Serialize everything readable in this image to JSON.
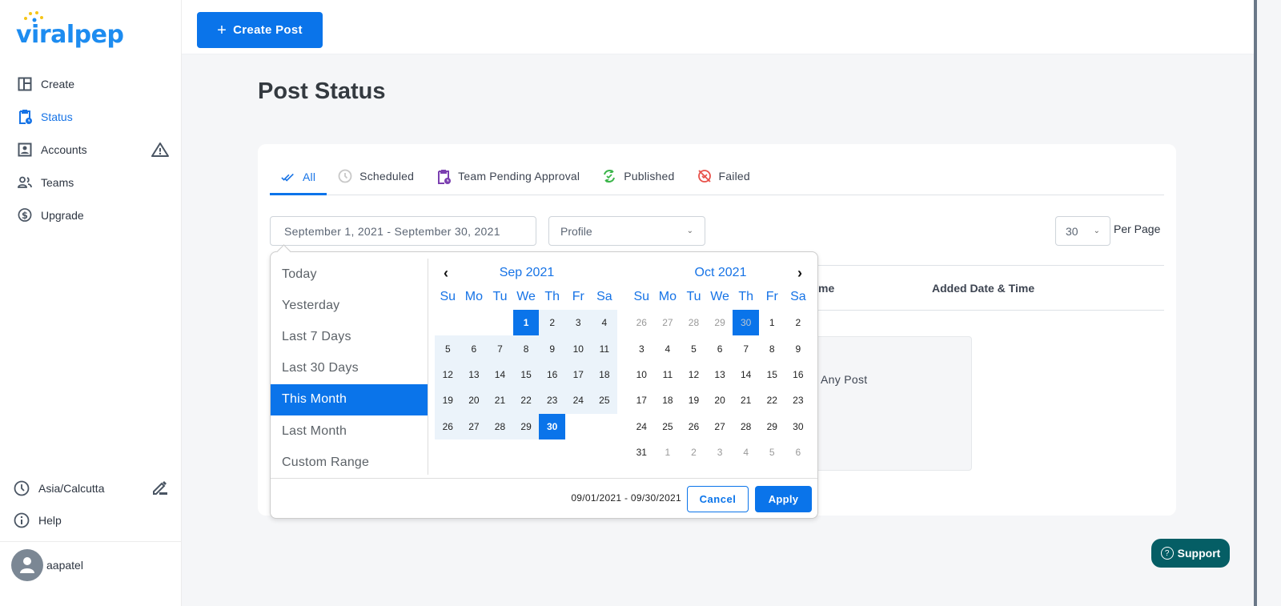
{
  "app": {
    "logo_text": "viralpep",
    "brand_color": "#1d8cf0",
    "accent_color": "#0a74ea"
  },
  "sidebar": {
    "items": [
      {
        "label": "Create",
        "icon": "layout-icon",
        "active": false
      },
      {
        "label": "Status",
        "icon": "clipboard-clock-icon",
        "active": true
      },
      {
        "label": "Accounts",
        "icon": "account-box-icon",
        "active": false,
        "badge_icon": "warning-icon"
      },
      {
        "label": "Teams",
        "icon": "people-icon",
        "active": false
      },
      {
        "label": "Upgrade",
        "icon": "dollar-circle-icon",
        "active": false
      }
    ],
    "timezone": "Asia/Calcutta",
    "help": "Help",
    "username": "aapatel"
  },
  "topbar": {
    "create_post_label": "Create Post"
  },
  "page": {
    "title": "Post Status"
  },
  "tabs": [
    {
      "label": "All",
      "icon": "double-check-icon",
      "active": true,
      "color": "#1673e6"
    },
    {
      "label": "Scheduled",
      "icon": "clock-icon",
      "active": false,
      "color": "#c8c8c8"
    },
    {
      "label": "Team Pending Approval",
      "icon": "clipboard-clock-icon",
      "active": false,
      "color": "#7b3fb0"
    },
    {
      "label": "Published",
      "icon": "refresh-check-icon",
      "active": false,
      "color": "#3bb54a"
    },
    {
      "label": "Failed",
      "icon": "failed-icon",
      "active": false,
      "color": "#e8514a"
    }
  ],
  "filters": {
    "date_range_value": "September 1, 2021 - September 30, 2021",
    "profile_placeholder": "Profile",
    "per_page_value": "30",
    "per_page_label": "Per Page"
  },
  "table": {
    "headers": [
      "me",
      "Added Date & Time"
    ],
    "empty_text": "Any Post"
  },
  "datepicker": {
    "ranges": [
      {
        "label": "Today",
        "active": false
      },
      {
        "label": "Yesterday",
        "active": false
      },
      {
        "label": "Last 7 Days",
        "active": false
      },
      {
        "label": "Last 30 Days",
        "active": false
      },
      {
        "label": "This Month",
        "active": true
      },
      {
        "label": "Last Month",
        "active": false
      },
      {
        "label": "Custom Range",
        "active": false
      }
    ],
    "weekdays": [
      "Su",
      "Mo",
      "Tu",
      "We",
      "Th",
      "Fr",
      "Sa"
    ],
    "left_month": {
      "title": "Sep 2021",
      "days": [
        [
          "",
          "",
          "",
          "1",
          "2",
          "3",
          "4"
        ],
        [
          "5",
          "6",
          "7",
          "8",
          "9",
          "10",
          "11"
        ],
        [
          "12",
          "13",
          "14",
          "15",
          "16",
          "17",
          "18"
        ],
        [
          "19",
          "20",
          "21",
          "22",
          "23",
          "24",
          "25"
        ],
        [
          "26",
          "27",
          "28",
          "29",
          "30",
          "",
          ""
        ]
      ],
      "start": "1",
      "end": "30"
    },
    "right_month": {
      "title": "Oct 2021",
      "days": [
        [
          "26",
          "27",
          "28",
          "29",
          "30",
          "1",
          "2"
        ],
        [
          "3",
          "4",
          "5",
          "6",
          "7",
          "8",
          "9"
        ],
        [
          "10",
          "11",
          "12",
          "13",
          "14",
          "15",
          "16"
        ],
        [
          "17",
          "18",
          "19",
          "20",
          "21",
          "22",
          "23"
        ],
        [
          "24",
          "25",
          "26",
          "27",
          "28",
          "29",
          "30"
        ],
        [
          "31",
          "1",
          "2",
          "3",
          "4",
          "5",
          "6"
        ]
      ],
      "off_days": [
        [
          0,
          0
        ],
        [
          0,
          1
        ],
        [
          0,
          2
        ],
        [
          0,
          3
        ],
        [
          0,
          4
        ],
        [
          5,
          1
        ],
        [
          5,
          2
        ],
        [
          5,
          3
        ],
        [
          5,
          4
        ],
        [
          5,
          5
        ],
        [
          5,
          6
        ]
      ],
      "selected_off": [
        0,
        4
      ]
    },
    "selected_text": "09/01/2021 - 09/30/2021",
    "cancel_label": "Cancel",
    "apply_label": "Apply"
  },
  "support": {
    "label": "Support"
  }
}
